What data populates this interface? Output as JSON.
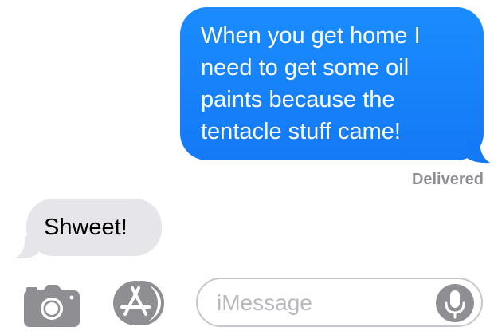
{
  "messages": [
    {
      "direction": "sent",
      "lines": [
        "When you get home I",
        "need to get some oil",
        "paints because the",
        "tentacle stuff came!"
      ],
      "status": "Delivered"
    },
    {
      "direction": "received",
      "text": "Shweet!"
    }
  ],
  "input_bar": {
    "placeholder": "iMessage",
    "value": "",
    "camera_icon": "camera-icon",
    "apps_icon": "app-store-icon",
    "mic_icon": "microphone-icon"
  },
  "colors": {
    "sent_bubble": "#1a8cff",
    "received_bubble": "#e5e5ea",
    "status_text": "#8e8e93",
    "icon_gray": "#8e8e93"
  }
}
